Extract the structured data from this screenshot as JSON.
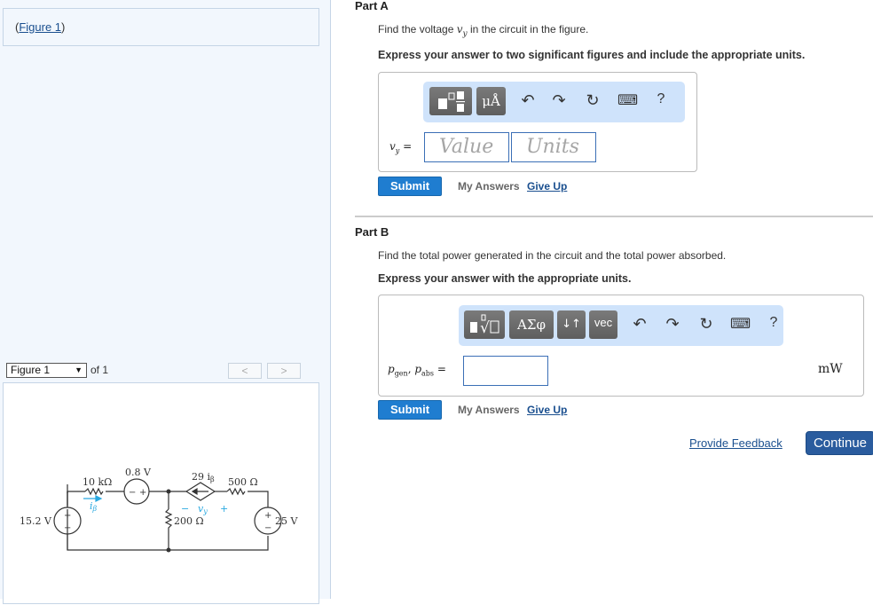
{
  "left_panel": {
    "figure_link_prefix": "(",
    "figure_link": "Figure 1",
    "figure_link_suffix": ")",
    "figure_select": "Figure 1",
    "figure_of": "of 1",
    "prev_label": "<",
    "next_label": ">",
    "circuit": {
      "source_left": "15.2 V",
      "resistor_1": "10 kΩ",
      "current_label": "i",
      "current_sub": "β",
      "source_mid": "0.8 V",
      "source_mid_minus": "−",
      "source_mid_plus": "+",
      "dependent_source": "29 i",
      "dependent_sub": "β",
      "resistor_2": "500 Ω",
      "resistor_3": "200 Ω",
      "voltage_label": "v",
      "voltage_sub": "y",
      "vy_minus": "−",
      "vy_plus": "+",
      "source_right": "25 V",
      "plus": "+",
      "minus": "−",
      "accent_color": "#29a8e0"
    }
  },
  "part_a": {
    "title": "Part A",
    "question_prefix": "Find the voltage ",
    "question_var": "v",
    "question_sub": "y",
    "question_suffix": " in the circuit in the figure.",
    "instruction": "Express your answer to two significant figures and include the appropriate units.",
    "toolbar": {
      "templates_icon": "templates-icon",
      "units_button": "μÅ",
      "undo": "↶",
      "redo": "↷",
      "reset": "↻",
      "keyboard": "⌨",
      "help": "?"
    },
    "label_var": "v",
    "label_sub": "y",
    "label_eq": " =",
    "value_placeholder": "Value",
    "units_placeholder": "Units",
    "submit": "Submit",
    "my_answers": "My Answers",
    "give_up": "Give Up"
  },
  "part_b": {
    "title": "Part B",
    "question": "Find the total power generated in the circuit and the total power absorbed.",
    "instruction": "Express your answer with the appropriate units.",
    "toolbar": {
      "greek_button": "ΑΣφ",
      "arrows_button": "↓↑",
      "vec_button": "vec",
      "undo": "↶",
      "redo": "↷",
      "reset": "↻",
      "keyboard": "⌨",
      "help": "?"
    },
    "label_p1": "p",
    "label_p1_sub": "gen",
    "label_sep": ", ",
    "label_p2": "p",
    "label_p2_sub": "abs",
    "label_eq": " =",
    "input_value": "",
    "unit": "mW",
    "submit": "Submit",
    "my_answers": "My Answers",
    "give_up": "Give Up"
  },
  "footer": {
    "provide_feedback": "Provide Feedback",
    "continue": "Continue"
  }
}
